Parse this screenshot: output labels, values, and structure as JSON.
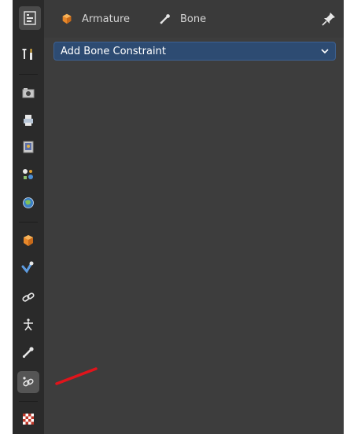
{
  "header": {
    "breadcrumb": [
      {
        "label": "Armature",
        "icon": "armature-object-icon"
      },
      {
        "label": "Bone",
        "icon": "bone-icon"
      }
    ],
    "pin_icon": "pin-icon",
    "editor_type_icon": "properties-editor-icon"
  },
  "tabs": [
    {
      "name": "tool",
      "icon": "wrench-screwdriver-icon"
    },
    {
      "name": "render",
      "icon": "camera-back-icon"
    },
    {
      "name": "output",
      "icon": "printer-icon"
    },
    {
      "name": "view-layer",
      "icon": "image-stack-icon"
    },
    {
      "name": "scene",
      "icon": "scene-icon"
    },
    {
      "name": "world",
      "icon": "globe-icon"
    },
    {
      "name": "object",
      "icon": "cube-icon"
    },
    {
      "name": "modifiers",
      "icon": "wrench-blue-icon"
    },
    {
      "name": "object-constraints",
      "icon": "chain-link-icon"
    },
    {
      "name": "object-data",
      "icon": "armature-figure-icon"
    },
    {
      "name": "bone",
      "icon": "bone-icon"
    },
    {
      "name": "bone-constraints",
      "icon": "bone-constraint-icon",
      "active": true
    },
    {
      "name": "texture",
      "icon": "checkerboard-icon"
    }
  ],
  "main": {
    "add_constraint_label": "Add Bone Constraint"
  },
  "colors": {
    "panel_bg": "#3d3d3d",
    "tabbar_bg": "#2a2a2a",
    "button_blue": "#2d4b72",
    "annotation_red": "#e0141b"
  }
}
